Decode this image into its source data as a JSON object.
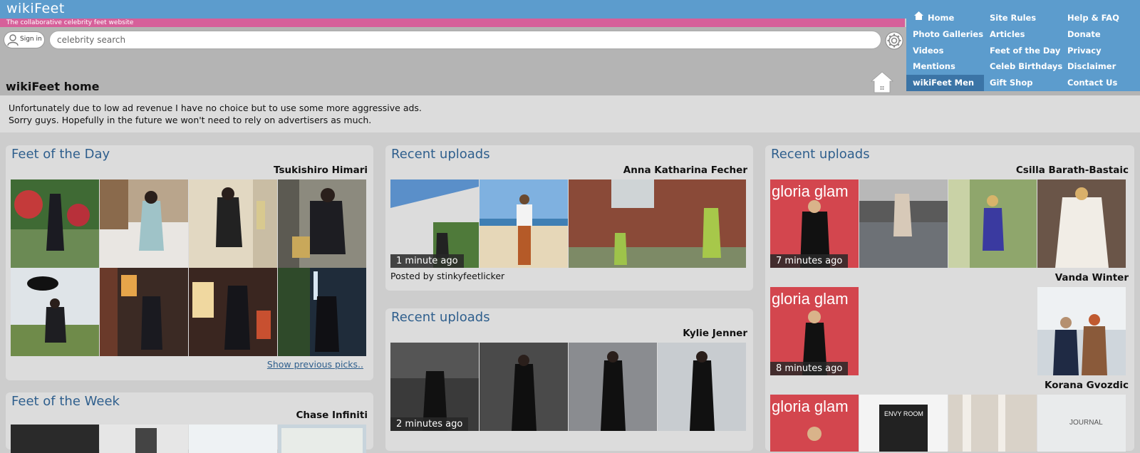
{
  "header": {
    "logo": "wikiFeet",
    "tagline": "The collaborative celebrity feet website",
    "signin_label": "Sign in",
    "search_placeholder": "celebrity search"
  },
  "nav": {
    "col1": [
      "Home",
      "Photo Galleries",
      "Videos",
      "Mentions",
      "wikiFeet Men"
    ],
    "col2": [
      "Site Rules",
      "Articles",
      "Feet of the Day",
      "Celeb Birthdays",
      "Gift Shop"
    ],
    "col3": [
      "Help & FAQ",
      "Donate",
      "Privacy",
      "Disclaimer",
      "Contact Us"
    ]
  },
  "page_title": "wikiFeet home",
  "notice": {
    "line1": "Unfortunately due to low ad revenue I have no choice but to use some more aggressive ads.",
    "line2": "Sorry guys. Hopefully in the future we won't need to rely on advertisers as much."
  },
  "feet_of_day": {
    "title": "Feet of the Day",
    "celeb": "Tsukishiro Himari",
    "show_previous": "Show previous picks.."
  },
  "feet_of_week": {
    "title": "Feet of the Week",
    "celeb": "Chase Infiniti"
  },
  "recent_mid_1": {
    "title": "Recent uploads",
    "celeb": "Anna Katharina Fecher",
    "time": "1 minute ago",
    "posted_by": "Posted by stinkyfeetlicker"
  },
  "recent_mid_2": {
    "title": "Recent uploads",
    "celeb": "Kylie Jenner",
    "time": "2 minutes ago"
  },
  "recent_right": {
    "title": "Recent uploads",
    "celeb1": "Csilla Barath-Bastaic",
    "time1": "7 minutes ago",
    "celeb2": "Vanda Winter",
    "time2": "8 minutes ago",
    "celeb3": "Korana Gvozdic",
    "gloria": "gloria glam",
    "journal": "JOURNAL",
    "envy": "ENVY ROOM"
  },
  "colors": {
    "topbar": "#5c9ccd",
    "tagbar": "#d6609a",
    "panel_title": "#2f5f8d"
  }
}
